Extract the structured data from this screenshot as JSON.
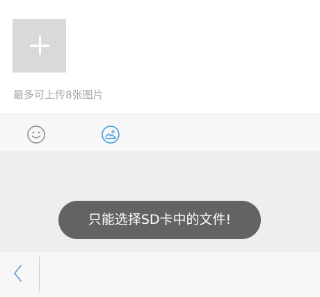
{
  "upload": {
    "add_icon": "plus-icon",
    "hint": "最多可上传8张图片"
  },
  "toolbar": {
    "emoji_icon": "smiley-icon",
    "image_icon": "image-icon",
    "accent_color": "#3a9bd9"
  },
  "toast": {
    "message": "只能选择SD卡中的文件!"
  },
  "bottom_bar": {
    "back_icon": "chevron-left-icon"
  },
  "colors": {
    "toast_bg": "#636363",
    "placeholder_bg": "#d9d9d9",
    "hint_text": "#a6a6a6"
  }
}
